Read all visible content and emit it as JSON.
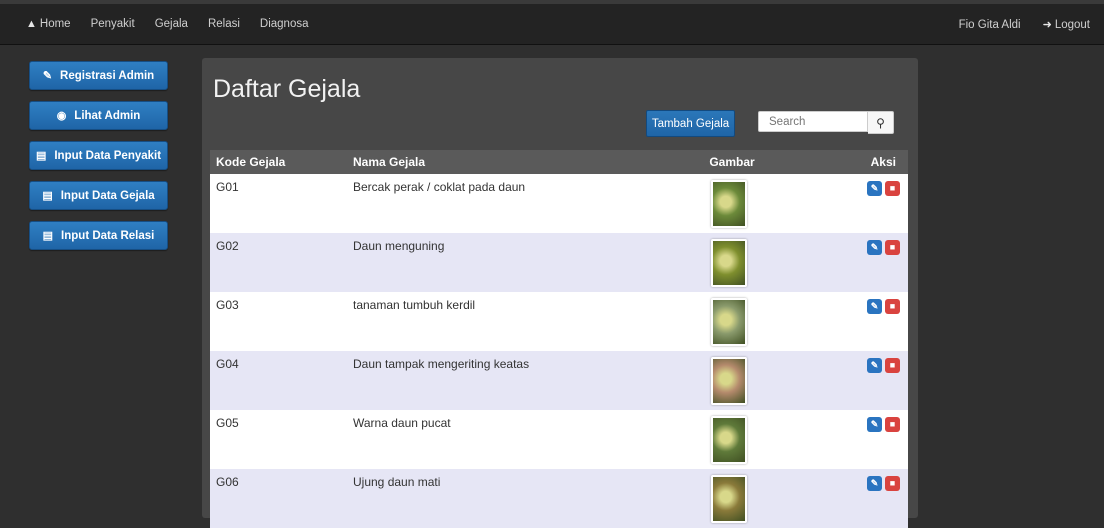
{
  "nav": {
    "home": "Home",
    "items": [
      "Penyakit",
      "Gejala",
      "Relasi",
      "Diagnosa"
    ],
    "user": "Fio Gita Aldi",
    "logout": "Logout"
  },
  "sidebar": {
    "items": [
      {
        "label": "Registrasi Admin",
        "icon": "pencil-icon"
      },
      {
        "label": "Lihat Admin",
        "icon": "eye-icon"
      },
      {
        "label": "Input Data Penyakit",
        "icon": "document-icon"
      },
      {
        "label": "Input Data Gejala",
        "icon": "document-icon"
      },
      {
        "label": "Input Data Relasi",
        "icon": "document-icon"
      }
    ]
  },
  "main": {
    "title": "Daftar Gejala",
    "add_label": "Tambah Gejala",
    "search_placeholder": "Search",
    "columns": [
      "Kode Gejala",
      "Nama Gejala",
      "Gambar",
      "Aksi"
    ],
    "rows": [
      {
        "kode": "G01",
        "nama": "Bercak perak / coklat pada daun",
        "thumb_color": "#6c8a3a"
      },
      {
        "kode": "G02",
        "nama": "Daun menguning",
        "thumb_color": "#7f8f2e"
      },
      {
        "kode": "G03",
        "nama": "tanaman tumbuh kerdil",
        "thumb_color": "#8a9a6c"
      },
      {
        "kode": "G04",
        "nama": "Daun tampak mengeriting keatas",
        "thumb_color": "#b48a6c"
      },
      {
        "kode": "G05",
        "nama": "Warna daun pucat",
        "thumb_color": "#5f7a3a"
      },
      {
        "kode": "G06",
        "nama": "Ujung daun mati",
        "thumb_color": "#8a7a3a"
      }
    ]
  },
  "colors": {
    "primary": "#1f65a7",
    "danger": "#d9433f",
    "row_alt": "#e6e6f5"
  }
}
